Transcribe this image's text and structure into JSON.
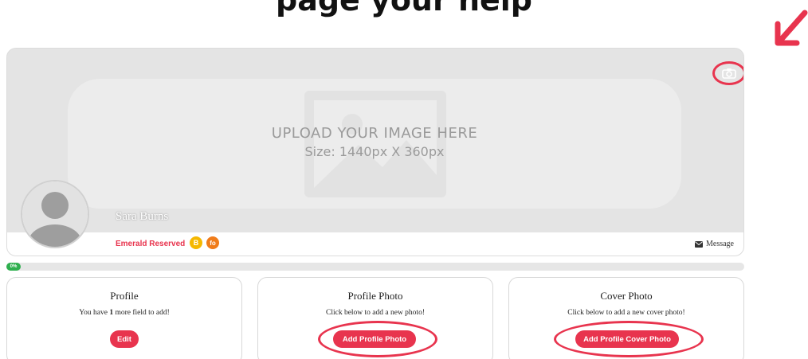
{
  "heading": "page your help",
  "cover": {
    "upload_title": "UPLOAD YOUR IMAGE HERE",
    "upload_size": "Size: 1440px X 360px"
  },
  "profile": {
    "name": "Sara Burns",
    "tier": "Emerald Reserved",
    "badges": [
      "B",
      "fo"
    ],
    "message_label": "Message"
  },
  "progress": {
    "label": "0%",
    "value": 0.02
  },
  "cards": [
    {
      "title": "Profile",
      "text_before": "You have ",
      "text_bold": "1",
      "text_after": " more field to add!",
      "button": "Edit"
    },
    {
      "title": "Profile Photo",
      "text": "Click below to add a new photo!",
      "button": "Add Profile Photo"
    },
    {
      "title": "Cover Photo",
      "text": "Click below to add a new cover photo!",
      "button": "Add Profile Cover Photo"
    }
  ],
  "colors": {
    "accent": "#e8344e",
    "progress": "#2eaf4e",
    "badge_gold": "#f5b800",
    "badge_orange": "#f07c1a"
  },
  "icons": [
    "camera-icon",
    "envelope-icon",
    "image-placeholder-icon",
    "arrow-down-left-icon",
    "user-silhouette-icon"
  ]
}
